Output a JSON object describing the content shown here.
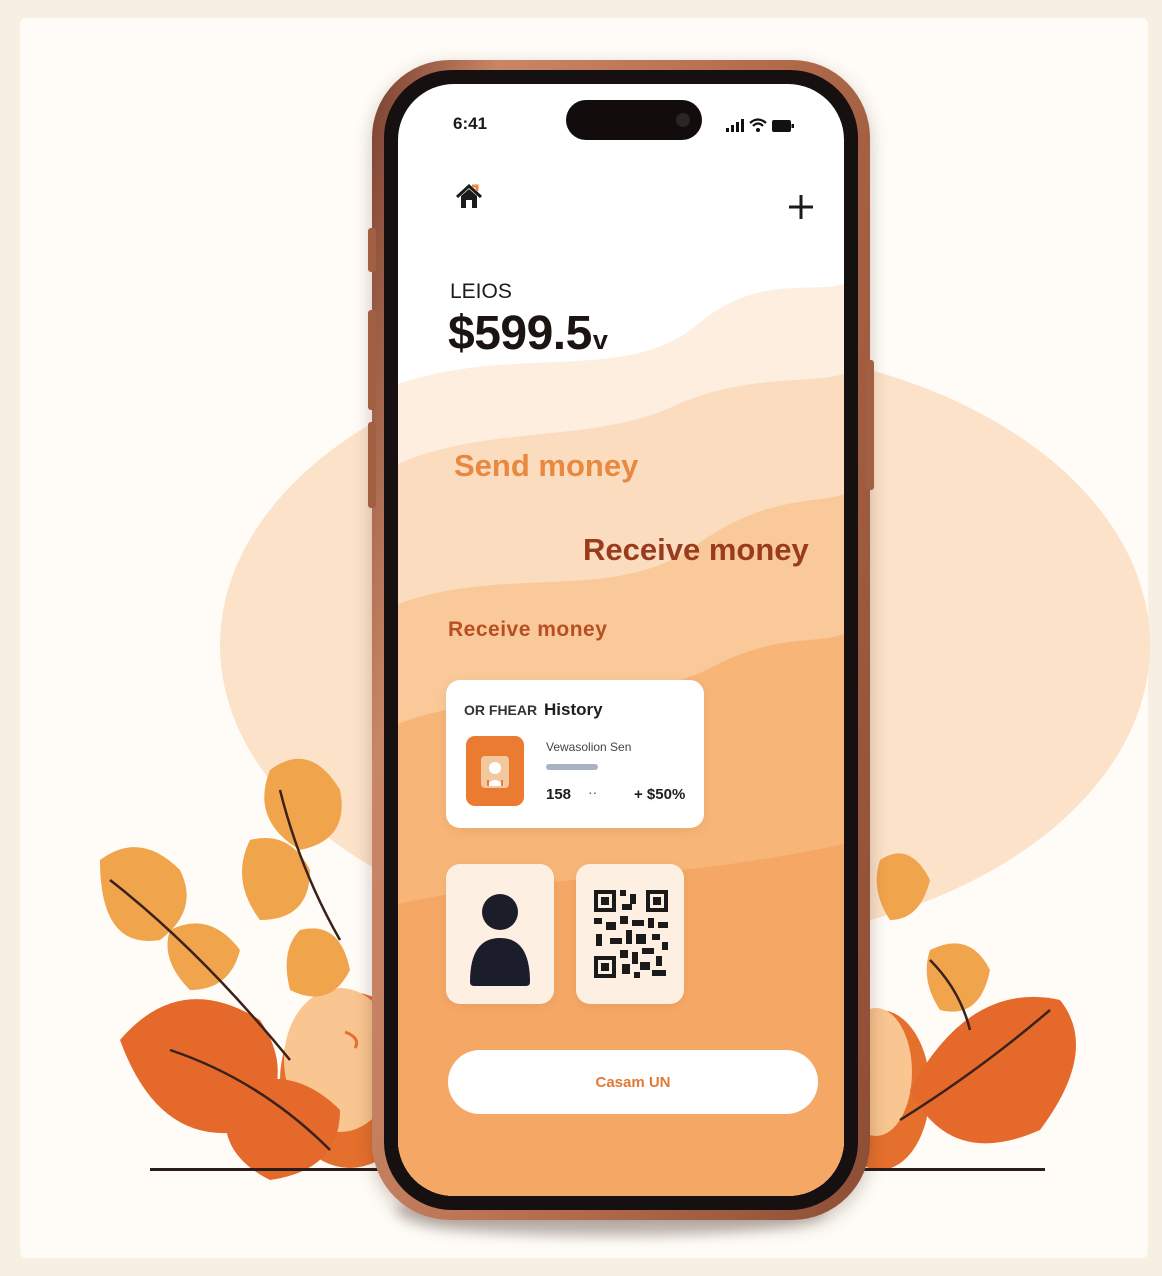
{
  "status_bar": {
    "time": "6:41",
    "icons": [
      "signal-icon",
      "wifi-icon",
      "battery-icon"
    ]
  },
  "header": {
    "home_icon": "home-icon",
    "add_icon": "plus-icon"
  },
  "account": {
    "label": "LEIOS",
    "balance": "$599.5",
    "balance_suffix": "v"
  },
  "actions": {
    "send": "Send money",
    "receive": "Receive money"
  },
  "section": {
    "title": "Receive money"
  },
  "history_card": {
    "tag": "OR FHEAR",
    "title": "History",
    "description": "Vewasolion Sen",
    "number": "158",
    "dots": "··",
    "amount": "+ $50%"
  },
  "tiles": [
    {
      "icon": "person-icon"
    },
    {
      "icon": "qr-code-icon"
    }
  ],
  "cta": {
    "label": "Casam UN"
  },
  "colors": {
    "accent_orange": "#e98940",
    "accent_dark": "#9a3b1e",
    "screen_orange": "#f5a766",
    "frame_copper": "#b56c4c"
  }
}
